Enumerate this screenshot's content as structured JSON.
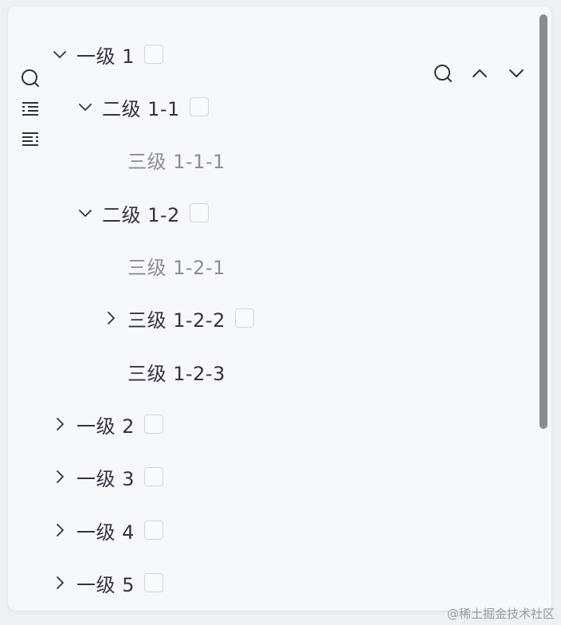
{
  "tree": {
    "nodes": [
      {
        "label": "一级 1",
        "arrow": "down",
        "checkbox": true,
        "muted": false
      },
      {
        "label": "二级 1-1",
        "arrow": "down",
        "checkbox": true,
        "muted": false
      },
      {
        "label": "三级 1-1-1",
        "arrow": "none",
        "checkbox": false,
        "muted": true
      },
      {
        "label": "二级 1-2",
        "arrow": "down",
        "checkbox": true,
        "muted": false
      },
      {
        "label": "三级 1-2-1",
        "arrow": "none",
        "checkbox": false,
        "muted": true
      },
      {
        "label": "三级 1-2-2",
        "arrow": "right",
        "checkbox": true,
        "muted": false
      },
      {
        "label": "三级 1-2-3",
        "arrow": "none",
        "checkbox": false,
        "muted": false
      },
      {
        "label": "一级 2",
        "arrow": "right",
        "checkbox": true,
        "muted": false
      },
      {
        "label": "一级 3",
        "arrow": "right",
        "checkbox": true,
        "muted": false
      },
      {
        "label": "一级 4",
        "arrow": "right",
        "checkbox": true,
        "muted": false
      },
      {
        "label": "一级 5",
        "arrow": "right",
        "checkbox": true,
        "muted": false
      }
    ]
  },
  "toolbar": {
    "left_icons": [
      "search-icon",
      "list-indent-icon",
      "list-outdent-icon"
    ],
    "right_icons": [
      "search-icon",
      "chevron-up-icon",
      "chevron-down-icon"
    ]
  },
  "watermark": "@稀土掘金技术社区",
  "colors": {
    "panel_bg": "#f7f8fc",
    "text": "#333344",
    "muted_text": "#8c8c9a",
    "scrollbar": "#8b8b90",
    "checkbox_border": "#d5d7de"
  }
}
